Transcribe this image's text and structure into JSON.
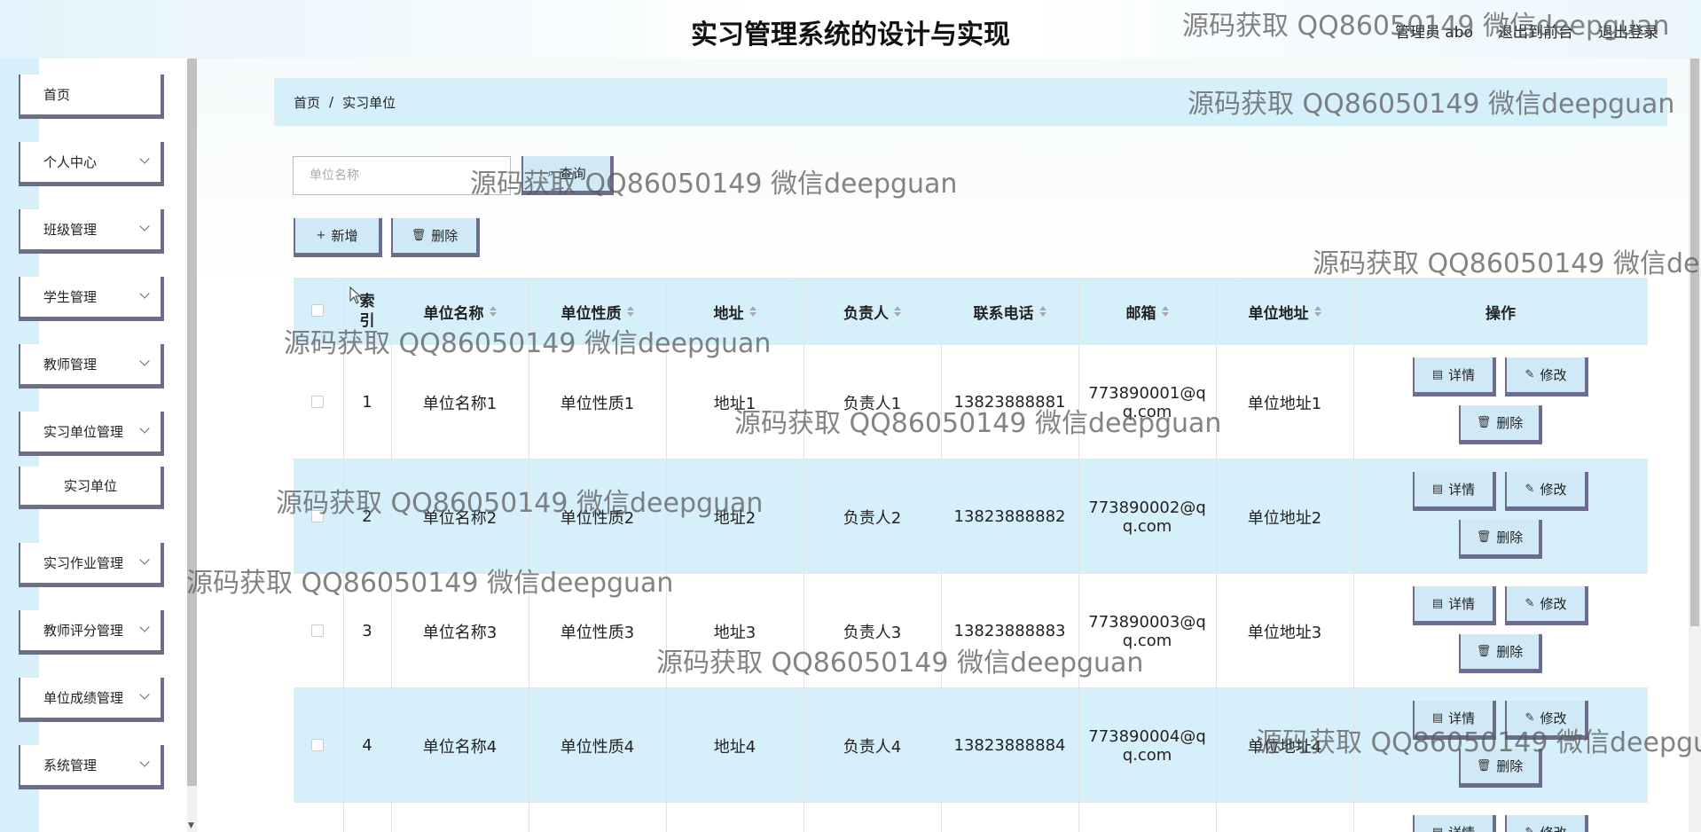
{
  "header": {
    "title": "实习管理系统的设计与实现",
    "user_label": "管理员 abo",
    "back_frontend": "退出到前台",
    "logout": "退出登录"
  },
  "sidebar": {
    "items": [
      {
        "label": "首页"
      },
      {
        "label": "个人中心"
      },
      {
        "label": "班级管理"
      },
      {
        "label": "学生管理"
      },
      {
        "label": "教师管理"
      },
      {
        "label": "实习单位管理"
      },
      {
        "label": "实习单位"
      },
      {
        "label": "实习作业管理"
      },
      {
        "label": "教师评分管理"
      },
      {
        "label": "单位成绩管理"
      },
      {
        "label": "系统管理"
      }
    ]
  },
  "breadcrumb": {
    "home": "首页",
    "sep": "/",
    "current": "实习单位"
  },
  "search": {
    "placeholder": "单位名称",
    "query_label": "查询"
  },
  "toolbar": {
    "add_label": "新增",
    "delete_label": "删除"
  },
  "table": {
    "headers": {
      "index": "索引",
      "name": "单位名称",
      "nature": "单位性质",
      "address": "地址",
      "manager": "负责人",
      "phone": "联系电话",
      "email": "邮箱",
      "unit_address": "单位地址",
      "actions": "操作"
    },
    "rows": [
      {
        "index": "1",
        "name": "单位名称1",
        "nature": "单位性质1",
        "address": "地址1",
        "manager": "负责人1",
        "phone": "13823888881",
        "email_l1": "773890001@q",
        "email_l2": "q.com",
        "unit_address": "单位地址1"
      },
      {
        "index": "2",
        "name": "单位名称2",
        "nature": "单位性质2",
        "address": "地址2",
        "manager": "负责人2",
        "phone": "13823888882",
        "email_l1": "773890002@q",
        "email_l2": "q.com",
        "unit_address": "单位地址2"
      },
      {
        "index": "3",
        "name": "单位名称3",
        "nature": "单位性质3",
        "address": "地址3",
        "manager": "负责人3",
        "phone": "13823888883",
        "email_l1": "773890003@q",
        "email_l2": "q.com",
        "unit_address": "单位地址3"
      },
      {
        "index": "4",
        "name": "单位名称4",
        "nature": "单位性质4",
        "address": "地址4",
        "manager": "负责人4",
        "phone": "13823888884",
        "email_l1": "773890004@q",
        "email_l2": "q.com",
        "unit_address": "单位地址4"
      }
    ],
    "actions": {
      "detail": "详情",
      "edit": "修改",
      "delete": "删除"
    }
  },
  "watermark": "源码获取 QQ86050149 微信deepguan",
  "colors": {
    "accent_bg": "#d6f0fb",
    "button_border": "#6d6c8f",
    "button_bg": "#cfe9f7"
  },
  "icons": {
    "chevron": "chevron-down-icon",
    "add": "plus-icon",
    "delete": "trash-icon",
    "detail": "document-icon",
    "edit": "pencil-icon",
    "query": "search-icon"
  }
}
